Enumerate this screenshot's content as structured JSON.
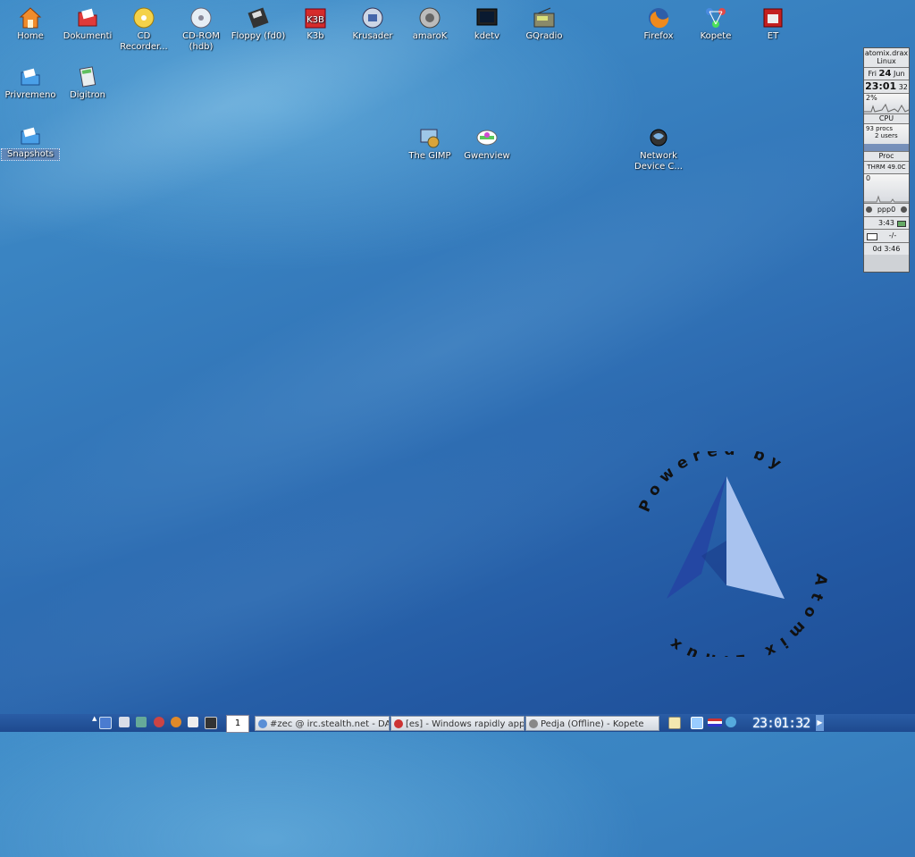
{
  "desktop_icons": [
    {
      "name": "home-icon",
      "label": "Home"
    },
    {
      "name": "dokumenti-icon",
      "label": "Dokumenti"
    },
    {
      "name": "cd-recorder-icon",
      "label": "CD Recorder..."
    },
    {
      "name": "cd-rom-icon",
      "label": "CD-ROM (hdb)"
    },
    {
      "name": "floppy-icon",
      "label": "Floppy (fd0)"
    },
    {
      "name": "k3b-icon",
      "label": "K3b"
    },
    {
      "name": "krusader-icon",
      "label": "Krusader"
    },
    {
      "name": "amarok-icon",
      "label": "amaroK"
    },
    {
      "name": "kdetv-icon",
      "label": "kdetv"
    },
    {
      "name": "gqradio-icon",
      "label": "GQradio"
    },
    {
      "name": "firefox-icon",
      "label": "Firefox"
    },
    {
      "name": "kopete-icon",
      "label": "Kopete"
    },
    {
      "name": "et-icon",
      "label": "ET"
    },
    {
      "name": "privremeno-icon",
      "label": "Privremeno"
    },
    {
      "name": "digitron-icon",
      "label": "Digitron"
    },
    {
      "name": "snapshots-icon",
      "label": "Snapshots"
    },
    {
      "name": "gimp-icon",
      "label": "The GIMP"
    },
    {
      "name": "gwenview-icon",
      "label": "Gwenview"
    },
    {
      "name": "network-device-icon",
      "label": "Network Device C..."
    }
  ],
  "gkrellm": {
    "host": "atomix.drax",
    "os": "Linux",
    "day": "Fri",
    "date": "24",
    "month": "Jun",
    "time": "23:01",
    "seconds": "32",
    "cpu_percent": "2%",
    "cpu_label": "CPU",
    "procs": "93 procs",
    "users": "2 users",
    "proc_label": "Proc",
    "thrm_label": "THRM",
    "thrm_value": "49.0C",
    "net_zero": "0",
    "net_label": "ppp0",
    "battery_time": "3:43",
    "mail": "-/-",
    "uptime": "0d 3:46"
  },
  "logo": {
    "text_top": "Powered by",
    "text_bottom": "Atomix Linux",
    "colors": {
      "light": "#a9c3ef",
      "dark": "#2447a3"
    }
  },
  "taskbar": {
    "pager_label": "1",
    "tasks": [
      {
        "label": "#zec @ irc.stealth.net - DA",
        "icon_color": "#5a8fd6"
      },
      {
        "label": "[es] - Windows rapidly appr",
        "icon_color": "#cc3333"
      },
      {
        "label": "Pedja (Offline) - Kopete",
        "icon_color": "#888888"
      }
    ],
    "clock": "23:01:32"
  }
}
